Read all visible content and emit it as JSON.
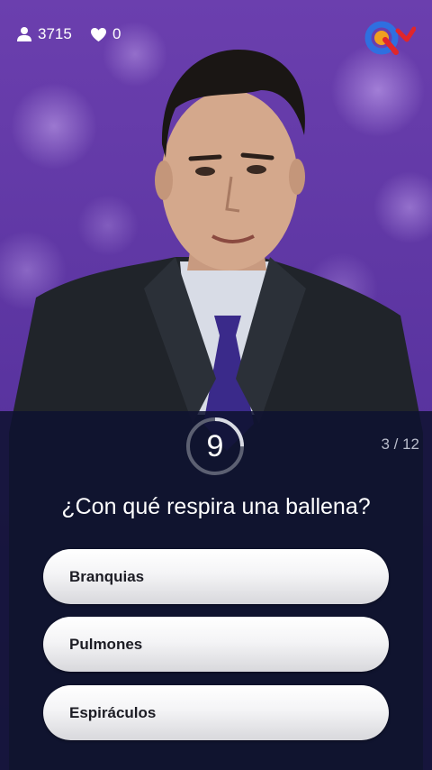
{
  "header": {
    "users_count": "3715",
    "lives_count": "0",
    "users_icon": "person-icon",
    "lives_icon": "heart-icon",
    "logo": "q12-logo"
  },
  "timer": {
    "seconds": "9",
    "remaining_fraction": 0.75
  },
  "progress": {
    "counter": "3 / 12"
  },
  "question": {
    "text": "¿Con qué respira una ballena?"
  },
  "options": [
    {
      "label": "Branquias"
    },
    {
      "label": "Pulmones"
    },
    {
      "label": "Espiráculos"
    }
  ],
  "colors": {
    "background": "#5a34a0",
    "panel": "#0e1230",
    "logo_blue": "#2f6fe0",
    "logo_orange": "#f0a020",
    "logo_red": "#e0262a"
  }
}
